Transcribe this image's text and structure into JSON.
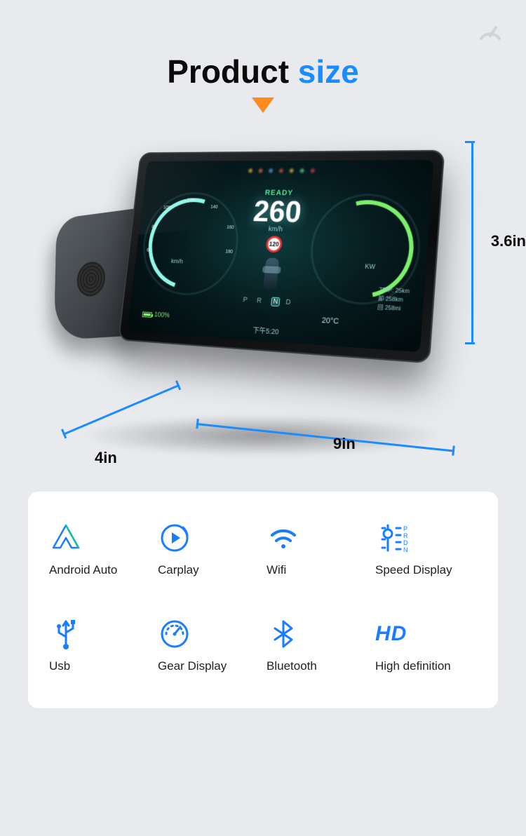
{
  "heading": {
    "word1": "Product",
    "word2": "size"
  },
  "dimensions": {
    "height": "3.6in",
    "width": "9in",
    "depth": "4in"
  },
  "dashboard": {
    "ready": "READY",
    "speed": "260",
    "speed_unit": "km/h",
    "speed_limit": "120",
    "gear_letters": "P R N D",
    "gear_selected": "N",
    "temperature": "20°C",
    "battery": "100%",
    "clock": "下午5:20",
    "kw_label": "KW",
    "left_unit": "km/h",
    "trip": {
      "line1": "TRIP: 25km",
      "line2": "卸 258km",
      "line3": "回 258mi"
    },
    "gauge_ticks": [
      "60",
      "80",
      "100",
      "120",
      "140",
      "160",
      "180"
    ]
  },
  "features": [
    {
      "id": "android-auto",
      "label": "Android Auto"
    },
    {
      "id": "carplay",
      "label": "Carplay"
    },
    {
      "id": "wifi",
      "label": "Wifi"
    },
    {
      "id": "speed-display",
      "label": "Speed Display",
      "gear_letters": [
        "P",
        "R",
        "D",
        "N"
      ]
    },
    {
      "id": "usb",
      "label": "Usb"
    },
    {
      "id": "gear-display",
      "label": "Gear Display"
    },
    {
      "id": "bluetooth",
      "label": "Bluetooth"
    },
    {
      "id": "hd",
      "label": "High definition",
      "badge": "HD"
    }
  ]
}
